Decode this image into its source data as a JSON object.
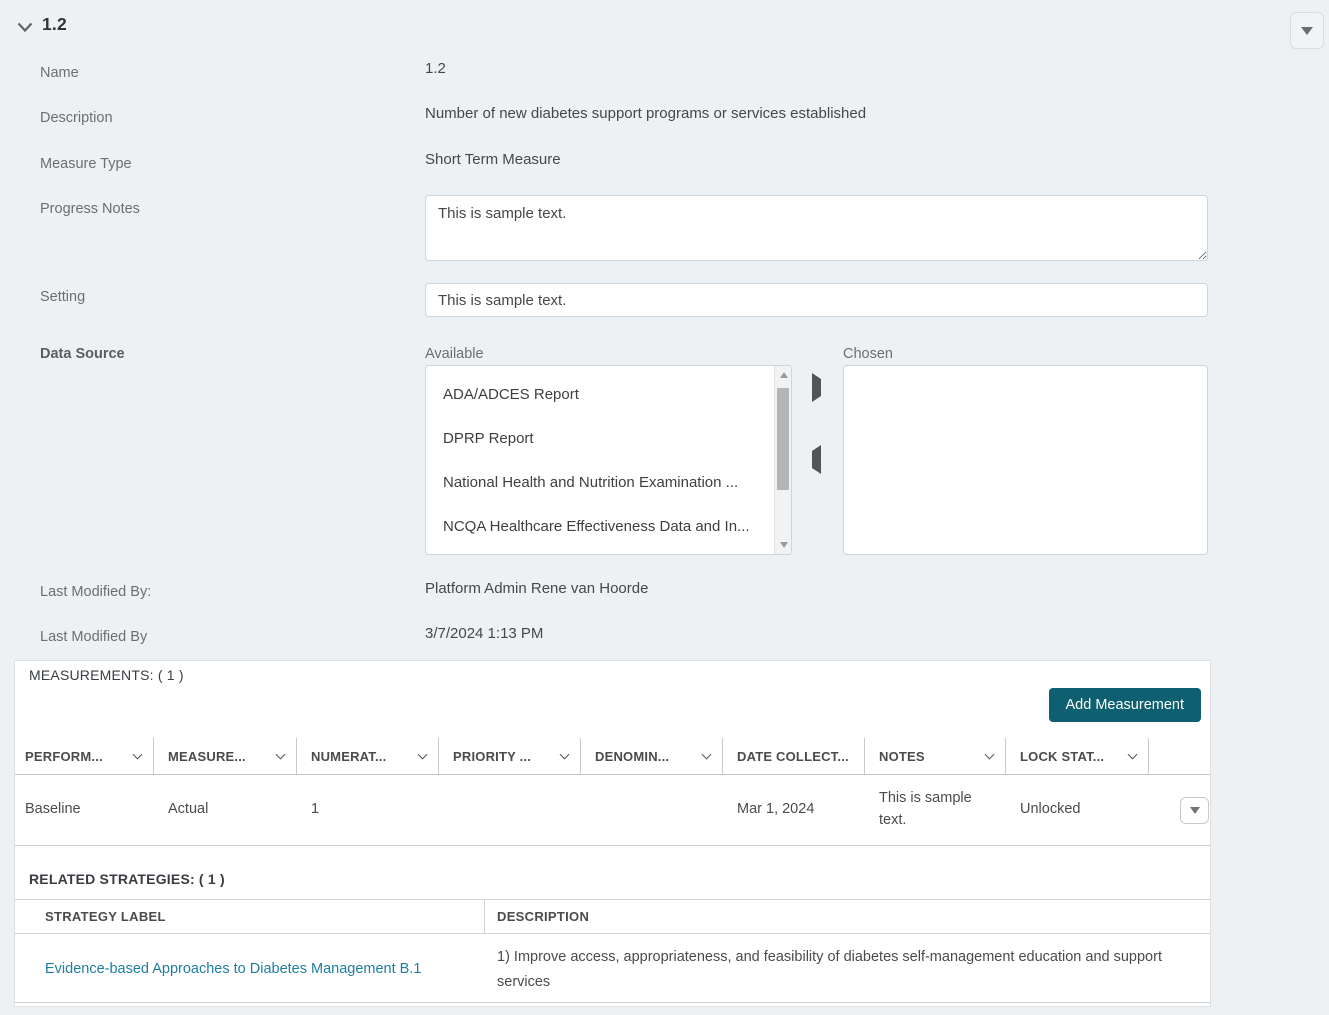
{
  "colors": {
    "page_bg": "#eef1f4",
    "accent_teal": "#0e5f70",
    "link_teal": "#1e7ea1"
  },
  "icons": {
    "collapse": "chevron-down",
    "header_menu": "caret-down",
    "move_right": "arrow-right",
    "move_left": "arrow-left",
    "scroll_up": "triangle-up",
    "scroll_down": "triangle-down",
    "row_menu": "caret-down"
  },
  "header": {
    "title": "1.2"
  },
  "form": {
    "name": {
      "label": "Name",
      "value": "1.2"
    },
    "description": {
      "label": "Description",
      "value": "Number of new diabetes support programs or services established"
    },
    "measure_type": {
      "label": "Measure Type",
      "value": "Short Term Measure"
    },
    "progress_notes": {
      "label": "Progress Notes",
      "value": "This is sample text."
    },
    "setting": {
      "label": "Setting",
      "value": "This is sample text."
    },
    "data_source": {
      "label": "Data Source",
      "available_label": "Available",
      "chosen_label": "Chosen",
      "available_items": [
        "ADA/ADCES Report",
        "DPRP Report",
        "National Health and Nutrition Examination ...",
        "NCQA Healthcare Effectiveness Data and In..."
      ],
      "chosen_items": []
    },
    "last_modified_by_name": {
      "label": "Last Modified By:",
      "value": "Platform Admin Rene van Hoorde"
    },
    "last_modified_by_date": {
      "label": "Last Modified By",
      "value": "3/7/2024 1:13 PM"
    }
  },
  "measurements": {
    "section_title": "MEASUREMENTS: ( 1 )",
    "add_button_label": "Add Measurement",
    "columns": [
      {
        "label": "PERFORM...",
        "sortable": true
      },
      {
        "label": "MEASURE...",
        "sortable": true
      },
      {
        "label": "NUMERAT...",
        "sortable": true
      },
      {
        "label": "PRIORITY ...",
        "sortable": true
      },
      {
        "label": "DENOMIN...",
        "sortable": true
      },
      {
        "label": "DATE COLLECT...",
        "sortable": false
      },
      {
        "label": "NOTES",
        "sortable": true
      },
      {
        "label": "LOCK STAT...",
        "sortable": true
      },
      {
        "label": "",
        "sortable": false
      }
    ],
    "rows": [
      {
        "performance": "Baseline",
        "measure": "Actual",
        "numerator": "1",
        "priority": "",
        "denominator": "",
        "date_collected": "Mar 1, 2024",
        "notes": "This is sample text.",
        "lock_status": "Unlocked"
      }
    ]
  },
  "related_strategies": {
    "section_title": "RELATED STRATEGIES: ( 1 )",
    "columns": {
      "label_col": "STRATEGY LABEL",
      "description_col": "DESCRIPTION"
    },
    "rows": [
      {
        "strategy_label": "Evidence-based Approaches to Diabetes Management B.1",
        "description": "1) Improve access, appropriateness, and feasibility of diabetes self-management education and support services"
      }
    ]
  }
}
